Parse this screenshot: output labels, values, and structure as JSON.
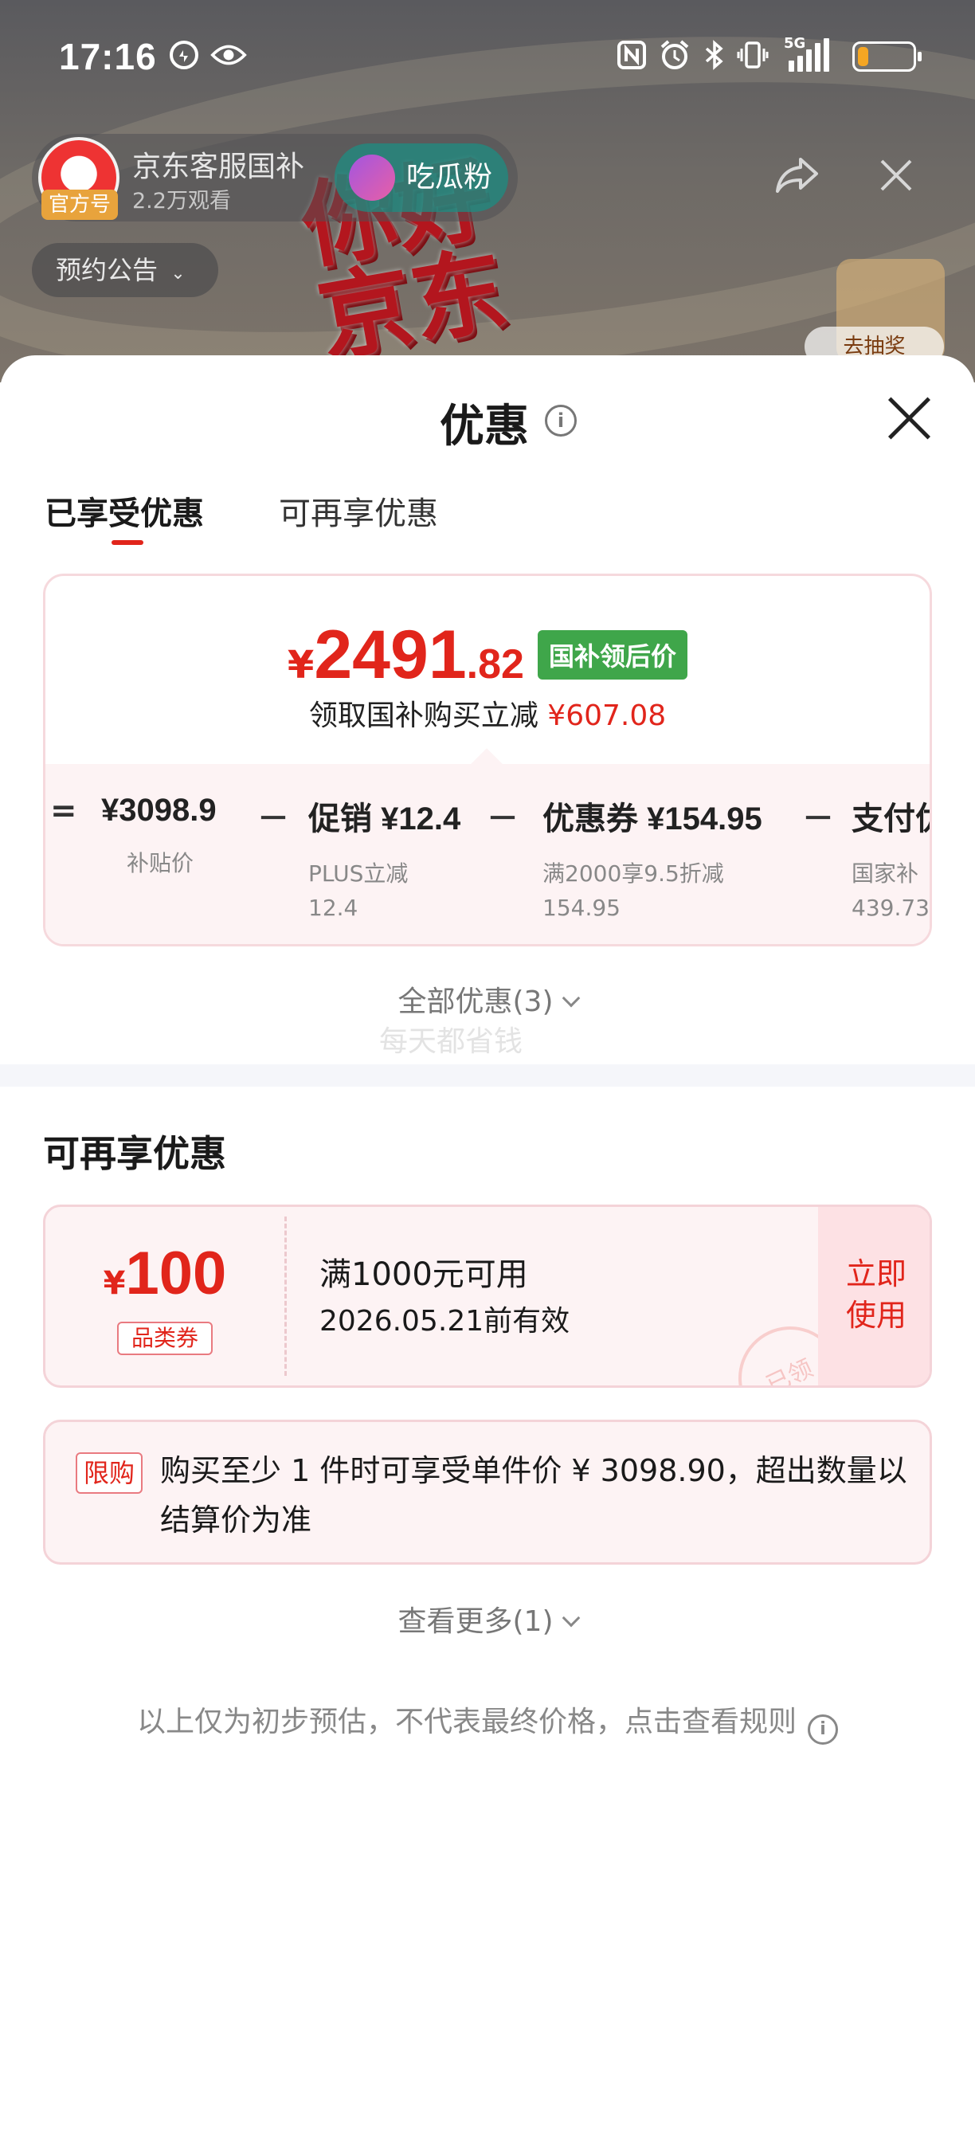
{
  "status_bar": {
    "time": "17:16",
    "network": "5G",
    "battery_level": 0.2,
    "icons": [
      "data-saver-icon",
      "eye-icon",
      "nfc-icon",
      "alarm-icon",
      "bluetooth-icon",
      "vibrate-icon",
      "signal-icon",
      "battery-icon"
    ]
  },
  "stream": {
    "streamer_name": "京东客服国补",
    "official_badge": "官方号",
    "views": "2.2万观看",
    "fan_button": "吃瓜粉",
    "notice_button": "预约公告",
    "logo_text": "你好\n京东",
    "lottery_label": "去抽奖"
  },
  "sheet": {
    "title": "优惠",
    "tabs": [
      {
        "label": "已享受优惠",
        "active": true
      },
      {
        "label": "可再享优惠",
        "active": false
      }
    ],
    "price": {
      "symbol": "¥",
      "integer": "2491",
      "decimal": ".82",
      "tag": "国补领后价",
      "subtitle": "领取国补购买立减",
      "saving": "¥607.08"
    },
    "breakdown": [
      {
        "op": "=",
        "main": "¥3098.9",
        "label": "补贴价",
        "amount": ""
      },
      {
        "op": "－",
        "main": "促销 ¥12.4",
        "label": "PLUS立减",
        "amount": "12.4"
      },
      {
        "op": "－",
        "main": "优惠券 ¥154.95",
        "label": "满2000享9.5折减",
        "amount": "154.95"
      },
      {
        "op": "－",
        "main": "支付优",
        "label": "国家补",
        "amount": "439.73"
      }
    ],
    "all_discounts": "全部优惠(3)",
    "watermark": "每天都省钱",
    "more_section_title": "可再享优惠",
    "coupon": {
      "symbol": "¥",
      "value": "100",
      "type": "品类券",
      "condition": "满1000元可用",
      "validity": "2026.05.21前有效",
      "stamp": "已领",
      "action": "立即\n使用"
    },
    "limit": {
      "badge": "限购",
      "text": "购买至少 1 件时可享受单件价 ¥ 3098.90，超出数量以结算价为准"
    },
    "see_more": "查看更多(1)",
    "disclaimer": "以上仅为初步预估，不代表最终价格，点击查看规则"
  },
  "colors": {
    "accent_red": "#e1251b",
    "tag_green": "#3fa64a",
    "card_bg": "#fdf3f4"
  }
}
